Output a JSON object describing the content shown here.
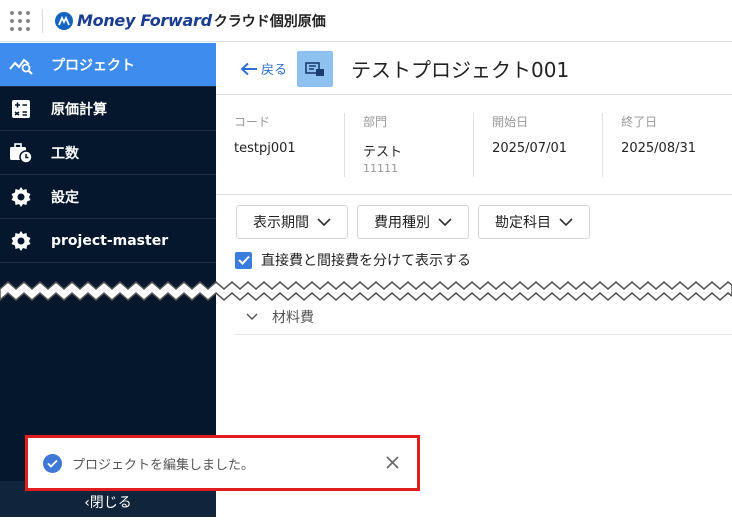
{
  "app": {
    "brand_name": "Money Forward",
    "brand_sub": "クラウド個別原価"
  },
  "sidebar": {
    "items": [
      {
        "label": "プロジェクト",
        "icon": "chart-icon",
        "active": true
      },
      {
        "label": "原価計算",
        "icon": "calculator-icon",
        "active": false
      },
      {
        "label": "工数",
        "icon": "clock-briefcase-icon",
        "active": false
      },
      {
        "label": "設定",
        "icon": "gear-icon",
        "active": false
      },
      {
        "label": "project-master",
        "icon": "gear-icon",
        "active": false
      }
    ],
    "close_label": "‹閉じる"
  },
  "header": {
    "back_label": "戻る",
    "title": "テストプロジェクト001"
  },
  "info": {
    "code_label": "コード",
    "code_value": "testpj001",
    "dept_label": "部門",
    "dept_value": "テスト",
    "dept_code": "11111",
    "start_label": "開始日",
    "start_value": "2025/07/01",
    "end_label": "終了日",
    "end_value": "2025/08/31"
  },
  "filters": {
    "period_label": "表示期間",
    "cost_type_label": "費用種別",
    "account_label": "勘定科目"
  },
  "options": {
    "split_label": "直接費と間接費を分けて表示する",
    "split_checked": true
  },
  "accordion": {
    "material_label": "材料費"
  },
  "toast": {
    "message": "プロジェクトを編集しました。"
  },
  "colors": {
    "accent": "#3e8cee",
    "sidebar_bg": "#04172d",
    "highlight_border": "#e01e1e"
  }
}
